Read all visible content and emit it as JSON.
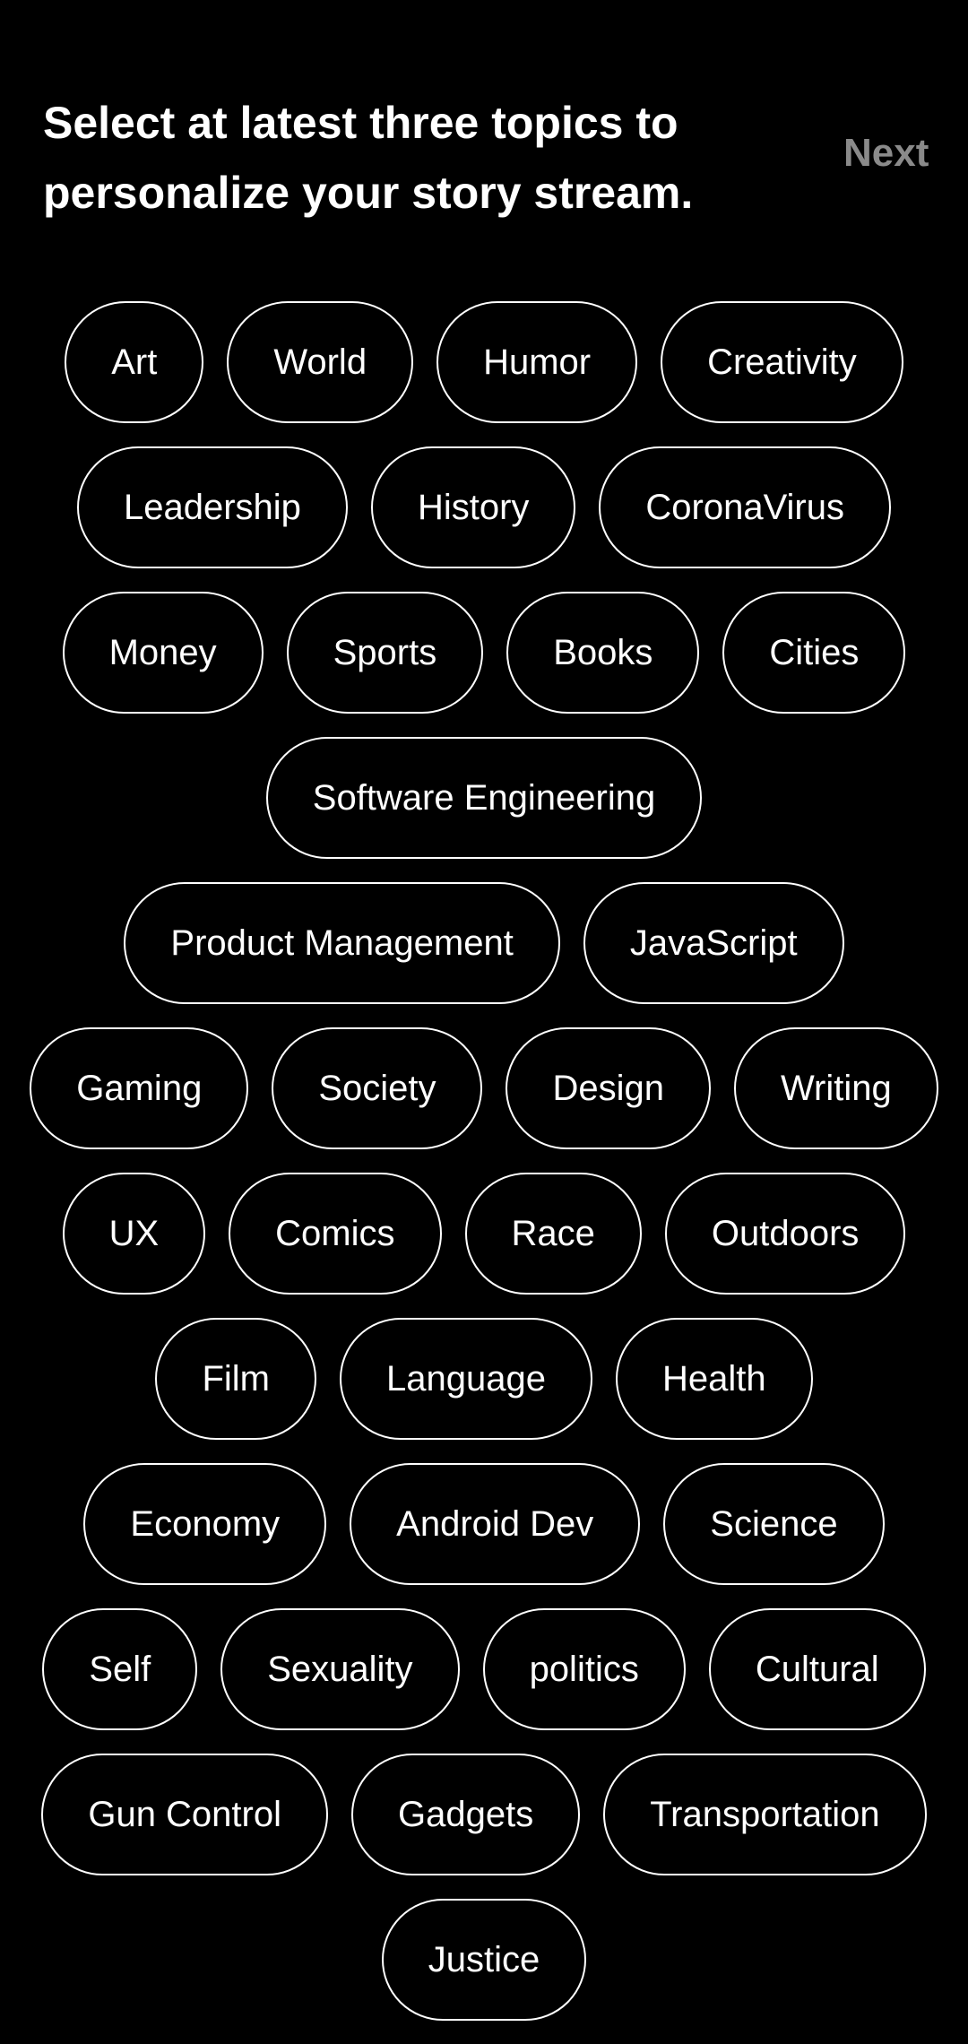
{
  "header": {
    "title": "Select at latest three topics to personalize your story stream.",
    "next_label": "Next"
  },
  "colors": {
    "background": "#000000",
    "text": "#ffffff",
    "next_disabled": "#8a8a8a",
    "chip_border": "#ffffff"
  },
  "topics": {
    "rows": [
      [
        "Art",
        "World",
        "Humor",
        "Creativity"
      ],
      [
        "Leadership",
        "History",
        "CoronaVirus"
      ],
      [
        "Money",
        "Sports",
        "Books",
        "Cities"
      ],
      [
        "Software Engineering"
      ],
      [
        "Product Management",
        "JavaScript"
      ],
      [
        "Gaming",
        "Society",
        "Design",
        "Writing"
      ],
      [
        "UX",
        "Comics",
        "Race",
        "Outdoors"
      ],
      [
        "Film",
        "Language",
        "Health"
      ],
      [
        "Economy",
        "Android Dev",
        "Science"
      ],
      [
        "Self",
        "Sexuality",
        "politics",
        "Cultural"
      ],
      [
        "Gun Control",
        "Gadgets",
        "Transportation"
      ],
      [
        "Justice"
      ]
    ]
  }
}
